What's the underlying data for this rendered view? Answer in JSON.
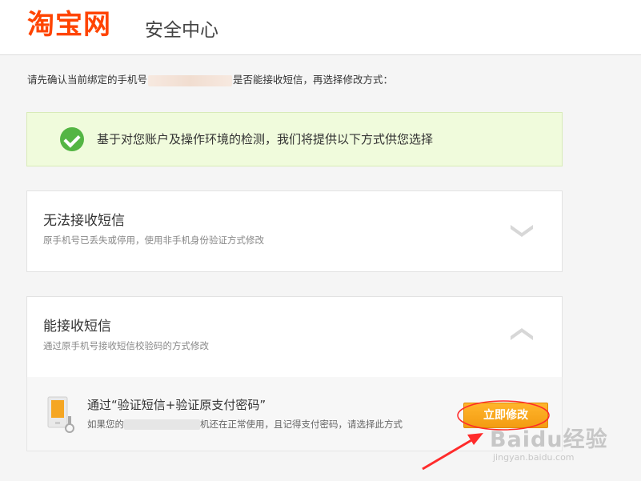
{
  "header": {
    "logo": "淘宝网",
    "site_name": "安全中心"
  },
  "intro": {
    "before": "请先确认当前绑定的手机号",
    "after": "是否能接收短信，再选择修改方式："
  },
  "notice": {
    "text": "基于对您账户及操作环境的检测，我们将提供以下方式供您选择"
  },
  "options": [
    {
      "title": "无法接收短信",
      "desc": "原手机号已丢失或停用，使用非手机身份验证方式修改",
      "state": "collapsed",
      "icon": "chevron-down-icon"
    },
    {
      "title": "能接收短信",
      "desc": "通过原手机号接收短信校验码的方式修改",
      "state": "expanded",
      "icon": "chevron-up-icon"
    }
  ],
  "method": {
    "title": "通过“验证短信+验证原支付密码”",
    "desc_before": "如果您的",
    "desc_after": "机还在正常使用，且记得支付密码，请选择此方式",
    "button": "立即修改",
    "icon": "phone-icon"
  },
  "annotation": {
    "color": "#ff2b2b"
  },
  "watermark": {
    "brand": "Baidu经验",
    "url": "jingyan.baidu.com"
  },
  "colors": {
    "brand": "#ff4400",
    "success": "#54b544",
    "button": "#f39c12",
    "notice_bg": "#f0fbdc"
  }
}
